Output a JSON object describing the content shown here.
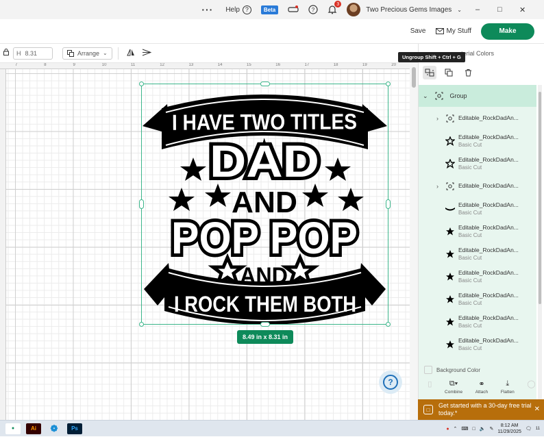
{
  "titlebar": {
    "help_label": "Help",
    "beta_label": "Beta",
    "notification_count": "3",
    "account_name": "Two Precious Gems Images"
  },
  "header": {
    "save_label": "Save",
    "mystuff_label": "My Stuff",
    "make_label": "Make"
  },
  "toolbar": {
    "height_label": "H",
    "height_value": "8.31",
    "arrange_label": "Arrange"
  },
  "ruler": {
    "marks": [
      "7",
      "8",
      "9",
      "10",
      "11",
      "12",
      "13",
      "14",
      "15",
      "16",
      "17",
      "18",
      "19",
      "20"
    ]
  },
  "canvas": {
    "design_lines": [
      "I HAVE TWO TITLES",
      "DAD",
      "AND",
      "POP POP",
      "AND",
      "I ROCK THEM BOTH"
    ],
    "size_badge": "8.49  in x 8.31  in"
  },
  "panel": {
    "tab_label": "aterial Colors",
    "tooltip": "Ungroup Shift + Ctrl + G",
    "group_label": "Group",
    "layers": [
      {
        "name": "Editable_RockDadAn...",
        "sub": "",
        "icon": "group-icon",
        "expandable": true
      },
      {
        "name": "Editable_RockDadAn...",
        "sub": "Basic Cut",
        "icon": "star-outline-icon",
        "expandable": false
      },
      {
        "name": "Editable_RockDadAn...",
        "sub": "Basic Cut",
        "icon": "star-outline-icon",
        "expandable": false
      },
      {
        "name": "Editable_RockDadAn...",
        "sub": "",
        "icon": "group-icon",
        "expandable": true
      },
      {
        "name": "Editable_RockDadAn...",
        "sub": "Basic Cut",
        "icon": "banner-shape-icon",
        "expandable": false
      },
      {
        "name": "Editable_RockDadAn...",
        "sub": "Basic Cut",
        "icon": "star-filled-icon",
        "expandable": false
      },
      {
        "name": "Editable_RockDadAn...",
        "sub": "Basic Cut",
        "icon": "star-filled-icon",
        "expandable": false
      },
      {
        "name": "Editable_RockDadAn...",
        "sub": "Basic Cut",
        "icon": "star-filled-icon",
        "expandable": false
      },
      {
        "name": "Editable_RockDadAn...",
        "sub": "Basic Cut",
        "icon": "star-filled-icon",
        "expandable": false
      },
      {
        "name": "Editable_RockDadAn...",
        "sub": "Basic Cut",
        "icon": "star-filled-icon",
        "expandable": false
      },
      {
        "name": "Editable_RockDadAn...",
        "sub": "Basic Cut",
        "icon": "star-filled-icon",
        "expandable": false
      }
    ],
    "background_color_label": "Background Color",
    "bottom_tools": [
      "Combine",
      "Attach",
      "Flatten"
    ]
  },
  "promo": {
    "text": "Get started with a 30-day free trial today.*"
  },
  "taskbar": {
    "time": "8:12 AM",
    "date": "11/29/2025",
    "notif_count": "11"
  },
  "colors": {
    "accent": "#0e8a5a",
    "selection": "#3bb58a",
    "layer_bg": "#e8f6ef",
    "group_bg": "#c9ecdc",
    "promo_bg": "#b76e0b"
  }
}
